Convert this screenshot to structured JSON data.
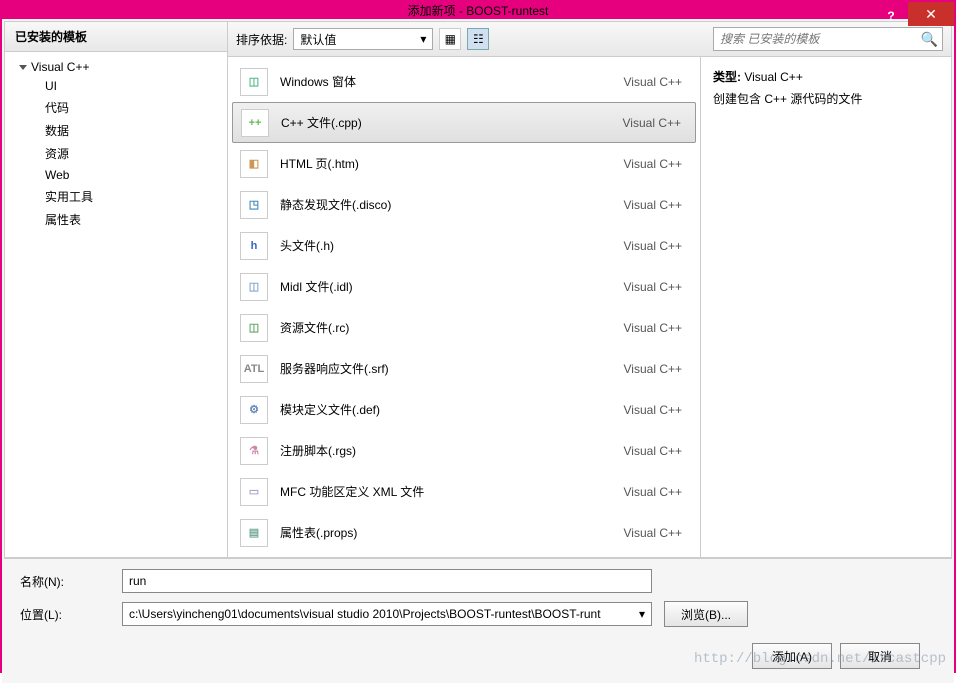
{
  "window": {
    "title": "添加新项 - BOOST-runtest"
  },
  "sidebar": {
    "header": "已安装的模板",
    "root": "Visual C++",
    "children": [
      "UI",
      "代码",
      "数据",
      "资源",
      "Web",
      "实用工具",
      "属性表"
    ]
  },
  "toolbar": {
    "sort_label": "排序依据:",
    "sort_value": "默认值",
    "search_placeholder": "搜索 已安装的模板"
  },
  "templates": [
    {
      "name": "Windows 窗体",
      "lang": "Visual C++",
      "icon": "◫",
      "color": "#5b8"
    },
    {
      "name": "C++ 文件(.cpp)",
      "lang": "Visual C++",
      "icon": "++",
      "color": "#6b5",
      "selected": true
    },
    {
      "name": "HTML 页(.htm)",
      "lang": "Visual C++",
      "icon": "◧",
      "color": "#c95"
    },
    {
      "name": "静态发现文件(.disco)",
      "lang": "Visual C++",
      "icon": "◳",
      "color": "#48b"
    },
    {
      "name": "头文件(.h)",
      "lang": "Visual C++",
      "icon": "h",
      "color": "#36c"
    },
    {
      "name": "Midl 文件(.idl)",
      "lang": "Visual C++",
      "icon": "◫",
      "color": "#8ac"
    },
    {
      "name": "资源文件(.rc)",
      "lang": "Visual C++",
      "icon": "◫",
      "color": "#6a6"
    },
    {
      "name": "服务器响应文件(.srf)",
      "lang": "Visual C++",
      "icon": "ATL",
      "color": "#888"
    },
    {
      "name": "模块定义文件(.def)",
      "lang": "Visual C++",
      "icon": "⚙",
      "color": "#68b"
    },
    {
      "name": "注册脚本(.rgs)",
      "lang": "Visual C++",
      "icon": "⚗",
      "color": "#c8a"
    },
    {
      "name": "MFC 功能区定义 XML 文件",
      "lang": "Visual C++",
      "icon": "▭",
      "color": "#aac"
    },
    {
      "name": "属性表(.props)",
      "lang": "Visual C++",
      "icon": "▤",
      "color": "#7a9"
    }
  ],
  "detail": {
    "type_label": "类型:",
    "type_value": "Visual C++",
    "description": "创建包含 C++ 源代码的文件"
  },
  "form": {
    "name_label": "名称(N):",
    "name_value": "run",
    "location_label": "位置(L):",
    "location_value": "c:\\Users\\yincheng01\\documents\\visual studio 2010\\Projects\\BOOST-runtest\\BOOST-runt",
    "browse_btn": "浏览(B)...",
    "add_btn": "添加(A)",
    "cancel_btn": "取消"
  },
  "watermark": "http://blog.csdn.net/itcastcpp"
}
